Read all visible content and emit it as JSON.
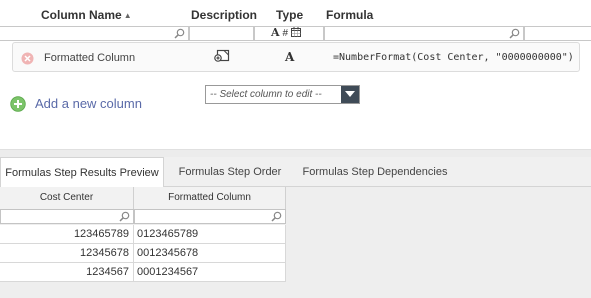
{
  "columns_grid": {
    "headers": {
      "name": "Column Name",
      "description": "Description",
      "type": "Type",
      "formula": "Formula"
    },
    "sort_indicator": "▲",
    "type_filter_glyphs": {
      "text": "A",
      "number": "#"
    },
    "rows": [
      {
        "name": "Formatted Column",
        "type_glyph": "A",
        "formula": "=NumberFormat(Cost Center, \"0000000000\")"
      }
    ],
    "add_link": "Add a new column",
    "select": {
      "placeholder": "-- Select column to edit --"
    }
  },
  "tabs": [
    {
      "label": "Formulas Step Results Preview",
      "active": true
    },
    {
      "label": "Formulas Step Order",
      "active": false
    },
    {
      "label": "Formulas Step Dependencies",
      "active": false
    }
  ],
  "preview": {
    "headers": [
      "Cost Center",
      "Formatted Column"
    ],
    "rows": [
      [
        "123465789",
        "0123465789"
      ],
      [
        "12345678",
        "0012345678"
      ],
      [
        "1234567",
        "0001234567"
      ]
    ]
  },
  "colors": {
    "accent_link": "#5a6aa8",
    "add_icon_green": "#7cc46a",
    "select_button": "#3f4b57",
    "delete_icon": "#f0b4b4"
  },
  "icons": {
    "sort": "sort-ascending-icon",
    "search": "magnifier-icon",
    "calendar": "calendar-icon",
    "delete": "delete-circle-icon",
    "description": "edit-description-icon",
    "add": "add-circle-icon",
    "dropdown": "caret-down-icon"
  }
}
